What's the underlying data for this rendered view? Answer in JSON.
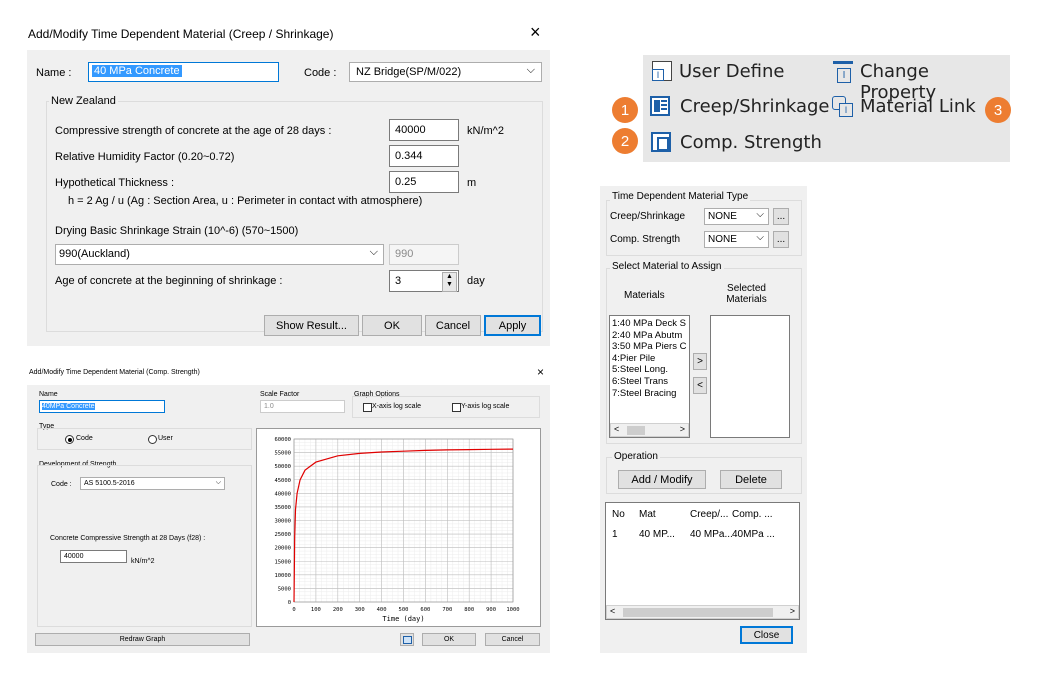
{
  "creep_dialog": {
    "title": "Add/Modify Time Dependent Material (Creep / Shrinkage)",
    "close": "×",
    "name_label": "Name :",
    "name_value": "40 MPa Concrete",
    "code_label": "Code :",
    "code_value": "NZ Bridge(SP/M/022)",
    "group_title": "New Zealand",
    "fc28_label": "Compressive strength of concrete at the age of 28 days :",
    "fc28_value": "40000",
    "fc28_unit": "kN/m^2",
    "rh_label": "Relative Humidity Factor (0.20~0.72)",
    "rh_value": "0.344",
    "thick_label": "Hypothetical Thickness :",
    "thick_value": "0.25",
    "thick_unit": "m",
    "thick_note": "h = 2 Ag / u (Ag : Section Area, u : Perimeter in contact with atmosphere)",
    "drying_label": "Drying Basic Shrinkage Strain (10^-6) (570~1500)",
    "drying_select": "990(Auckland)",
    "drying_value": "990",
    "age_label": "Age of concrete at the beginning of shrinkage :",
    "age_value": "3",
    "age_unit": "day",
    "buttons": {
      "show_result": "Show Result...",
      "ok": "OK",
      "cancel": "Cancel",
      "apply": "Apply"
    }
  },
  "ribbon": {
    "user_define": "User Define",
    "change_property": "Change Property",
    "creep_shrinkage": "Creep/Shrinkage",
    "material_link": "Material Link",
    "comp_strength": "Comp. Strength",
    "badge1": "1",
    "badge2": "2",
    "badge3": "3"
  },
  "strength_dialog": {
    "title": "Add/Modify Time Dependent Material (Comp. Strength)",
    "close": "×",
    "name_label": "Name",
    "name_value": "40MPa Concrete",
    "scale_label": "Scale Factor",
    "scale_value": "1.0",
    "graph_options_label": "Graph Options",
    "xlog_label": "X-axis log scale",
    "ylog_label": "Y-axis log scale",
    "type_label": "Type",
    "type_code": "Code",
    "type_user": "User",
    "dev_label": "Development of Strength",
    "code_label": "Code :",
    "code_value": "AS 5100.5-2016",
    "f28_label": "Concrete Compressive Strength at 28 Days (f28) :",
    "f28_value": "40000",
    "f28_unit": "kN/m^2",
    "redraw": "Redraw Graph",
    "ok": "OK",
    "cancel": "Cancel"
  },
  "chart_data": {
    "type": "line",
    "xlabel": "Time (day)",
    "ylabel": "",
    "xlim": [
      0,
      1000
    ],
    "ylim": [
      0,
      60000
    ],
    "xticks": [
      0,
      100,
      200,
      300,
      400,
      500,
      600,
      700,
      800,
      900,
      1000
    ],
    "yticks": [
      0,
      5000,
      10000,
      15000,
      20000,
      25000,
      30000,
      35000,
      40000,
      45000,
      50000,
      55000,
      60000
    ],
    "grid": true,
    "line_color": "#e00000",
    "series": [
      {
        "x": [
          0,
          3,
          7,
          14,
          28,
          50,
          100,
          200,
          300,
          400,
          500,
          600,
          700,
          800,
          900,
          1000
        ],
        "y": [
          0,
          24000,
          34000,
          40000,
          45000,
          48500,
          51500,
          53800,
          54700,
          55200,
          55500,
          55800,
          56000,
          56100,
          56200,
          56300
        ]
      }
    ]
  },
  "material_panel": {
    "type_group": "Time Dependent Material Type",
    "creep_label": "Creep/Shrinkage",
    "creep_value": "NONE",
    "comp_label": "Comp. Strength",
    "comp_value": "NONE",
    "dots": "...",
    "assign_group": "Select Material to Assign",
    "materials_header": "Materials",
    "selected_header": "Selected Materials",
    "materials": [
      "1:40 MPa Deck S",
      "2:40 MPa Abutm",
      "3:50 MPa Piers C",
      "4:Pier Pile",
      "5:Steel Long.",
      "6:Steel Trans",
      "7:Steel Bracing"
    ],
    "move_right": ">",
    "move_left": "<",
    "operation_group": "Operation",
    "add_modify": "Add / Modify",
    "delete": "Delete",
    "table_headers": [
      "No",
      "Mat",
      "Creep/...",
      "Comp. ..."
    ],
    "table_rows": [
      [
        "1",
        "40 MP...",
        "40 MPa...",
        "40MPa ..."
      ]
    ],
    "close": "Close"
  }
}
